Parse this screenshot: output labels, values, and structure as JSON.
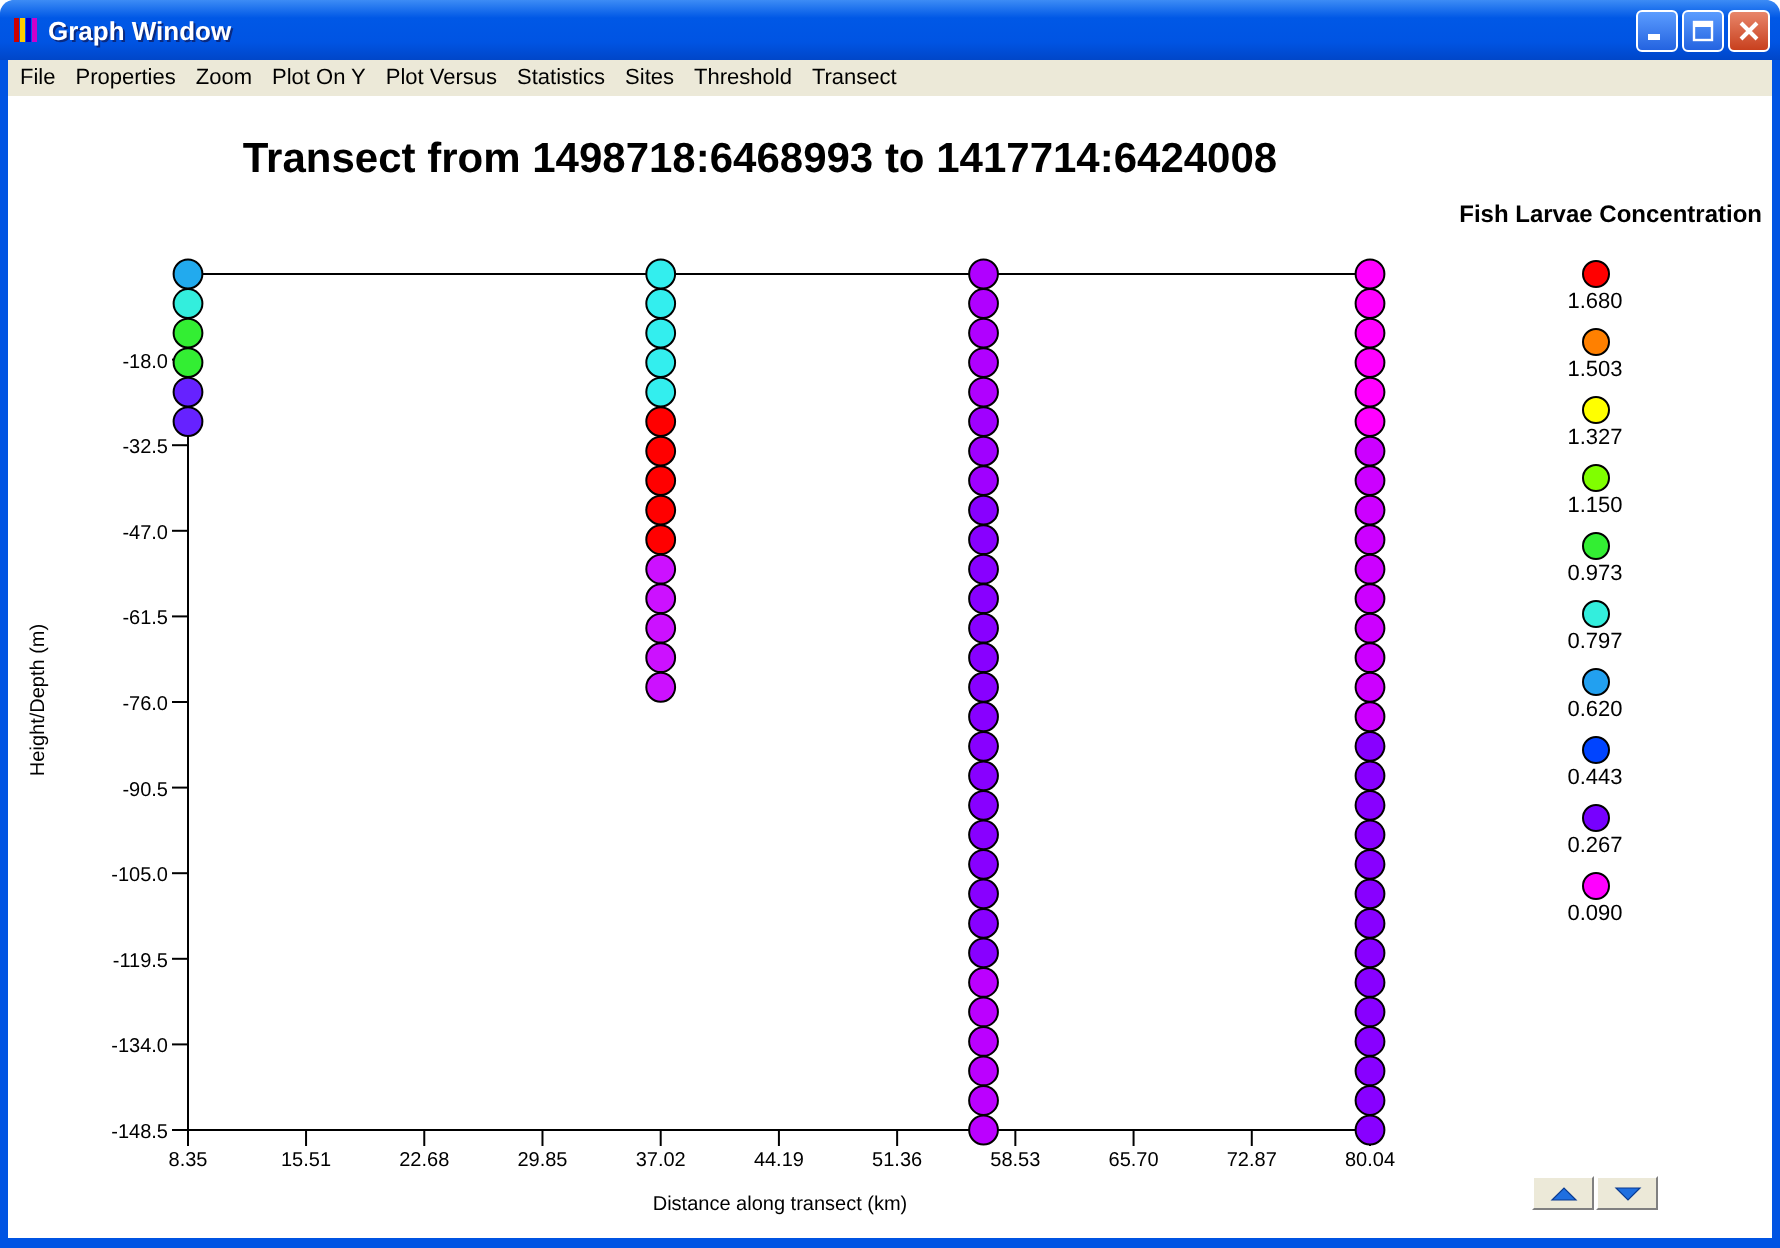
{
  "window": {
    "title": "Graph Window"
  },
  "menu": [
    "File",
    "Properties",
    "Zoom",
    "Plot On Y",
    "Plot Versus",
    "Statistics",
    "Sites",
    "Threshold",
    "Transect"
  ],
  "chart": {
    "chart_data": {
      "type": "scatter",
      "title": "Transect from 1498718:6468993 to 1417714:6424008",
      "xlabel": "Distance along transect (km)",
      "ylabel": "Height/Depth (m)",
      "xlim": [
        8.35,
        80.04
      ],
      "ylim": [
        -148.5,
        -3.5
      ],
      "xticks": [
        {
          "value": 8.35,
          "label": "8.35"
        },
        {
          "value": 15.51,
          "label": "15.51"
        },
        {
          "value": 22.68,
          "label": "22.68"
        },
        {
          "value": 29.85,
          "label": "29.85"
        },
        {
          "value": 37.02,
          "label": "37.02"
        },
        {
          "value": 44.19,
          "label": "44.19"
        },
        {
          "value": 51.36,
          "label": "51.36"
        },
        {
          "value": 58.53,
          "label": "58.53"
        },
        {
          "value": 65.7,
          "label": "65.70"
        },
        {
          "value": 72.87,
          "label": "72.87"
        },
        {
          "value": 80.04,
          "label": "80.04"
        }
      ],
      "yticks": [
        {
          "value": -18,
          "label": "-18.0"
        },
        {
          "value": -32.5,
          "label": "-32.5"
        },
        {
          "value": -47,
          "label": "-47.0"
        },
        {
          "value": -61.5,
          "label": "-61.5"
        },
        {
          "value": -76,
          "label": "-76.0"
        },
        {
          "value": -90.5,
          "label": "-90.5"
        },
        {
          "value": -105,
          "label": "-105.0"
        },
        {
          "value": -119.5,
          "label": "-119.5"
        },
        {
          "value": -134,
          "label": "-134.0"
        },
        {
          "value": -148.5,
          "label": "-148.5"
        }
      ],
      "series": [
        {
          "x": [
            8.35,
            8.35,
            8.35,
            8.35,
            8.35,
            8.35
          ],
          "values": [
            -3.5,
            -8.5,
            -13.5,
            -18.5,
            -23.5,
            -28.5
          ],
          "colors": [
            "#22aaee",
            "#33eedd",
            "#33ee33",
            "#33ee33",
            "#6622ff",
            "#6622ff"
          ]
        },
        {
          "x": [
            37.02,
            37.02,
            37.02,
            37.02,
            37.02,
            37.02,
            37.02,
            37.02,
            37.02,
            37.02,
            37.02,
            37.02,
            37.02,
            37.02,
            37.02
          ],
          "values": [
            -3.5,
            -8.5,
            -13.5,
            -18.5,
            -23.5,
            -28.5,
            -33.5,
            -38.5,
            -43.5,
            -48.5,
            -53.5,
            -58.5,
            -63.5,
            -68.5,
            -73.5
          ],
          "colors": [
            "#33eeee",
            "#33eeee",
            "#33eeee",
            "#33eeee",
            "#33eeee",
            "#ff0000",
            "#ff0000",
            "#ff0000",
            "#ff0000",
            "#ff0000",
            "#cc11ff",
            "#cc11ff",
            "#cc11ff",
            "#cc11ff",
            "#cc11ff"
          ]
        },
        {
          "x": [
            56.6,
            56.6,
            56.6,
            56.6,
            56.6,
            56.6,
            56.6,
            56.6,
            56.6,
            56.6,
            56.6,
            56.6,
            56.6,
            56.6,
            56.6,
            56.6,
            56.6,
            56.6,
            56.6,
            56.6,
            56.6,
            56.6,
            56.6,
            56.6,
            56.6,
            56.6,
            56.6,
            56.6,
            56.6,
            56.6
          ],
          "values": [
            -3.5,
            -8.5,
            -13.5,
            -18.5,
            -23.5,
            -28.5,
            -33.5,
            -38.5,
            -43.5,
            -48.5,
            -53.5,
            -58.5,
            -63.5,
            -68.5,
            -73.5,
            -78.5,
            -83.5,
            -88.5,
            -93.5,
            -98.5,
            -103.5,
            -108.5,
            -113.5,
            -118.5,
            -123.5,
            -128.5,
            -133.5,
            -138.5,
            -143.5,
            -148.5
          ],
          "colors": [
            "#b000ff",
            "#b000ff",
            "#b000ff",
            "#b000ff",
            "#b000ff",
            "#a000ff",
            "#a000ff",
            "#a000ff",
            "#8800ff",
            "#8800ff",
            "#8800ff",
            "#8800ff",
            "#8800ff",
            "#8800ff",
            "#8800ff",
            "#8800ff",
            "#8800ff",
            "#8800ff",
            "#8800ff",
            "#8800ff",
            "#8800ff",
            "#8800ff",
            "#8800ff",
            "#8800ff",
            "#bb00ff",
            "#bb00ff",
            "#bb00ff",
            "#bb00ff",
            "#bb00ff",
            "#bb00ff"
          ]
        },
        {
          "x": [
            80.04,
            80.04,
            80.04,
            80.04,
            80.04,
            80.04,
            80.04,
            80.04,
            80.04,
            80.04,
            80.04,
            80.04,
            80.04,
            80.04,
            80.04,
            80.04,
            80.04,
            80.04,
            80.04,
            80.04,
            80.04,
            80.04,
            80.04,
            80.04,
            80.04,
            80.04,
            80.04,
            80.04,
            80.04,
            80.04
          ],
          "values": [
            -3.5,
            -8.5,
            -13.5,
            -18.5,
            -23.5,
            -28.5,
            -33.5,
            -38.5,
            -43.5,
            -48.5,
            -53.5,
            -58.5,
            -63.5,
            -68.5,
            -73.5,
            -78.5,
            -83.5,
            -88.5,
            -93.5,
            -98.5,
            -103.5,
            -108.5,
            -113.5,
            -118.5,
            -123.5,
            -128.5,
            -133.5,
            -138.5,
            -143.5,
            -148.5
          ],
          "colors": [
            "#ff00ff",
            "#ff00ff",
            "#ff00ff",
            "#ff00ff",
            "#ff00ff",
            "#ff00ff",
            "#cc00ff",
            "#cc00ff",
            "#cc00ff",
            "#cc00ff",
            "#cc00ff",
            "#cc00ff",
            "#cc00ff",
            "#cc00ff",
            "#cc00ff",
            "#cc00ff",
            "#8800ff",
            "#8800ff",
            "#8800ff",
            "#8800ff",
            "#8800ff",
            "#8800ff",
            "#8800ff",
            "#8800ff",
            "#8800ff",
            "#8800ff",
            "#8800ff",
            "#8800ff",
            "#8800ff",
            "#8800ff"
          ]
        }
      ]
    }
  },
  "legend": {
    "title": "Fish Larvae Concentration",
    "items": [
      {
        "label": "1.680",
        "color": "#ff0000"
      },
      {
        "label": "1.503",
        "color": "#ff8000"
      },
      {
        "label": "1.327",
        "color": "#ffff00"
      },
      {
        "label": "1.150",
        "color": "#80ff00"
      },
      {
        "label": "0.973",
        "color": "#33ee33"
      },
      {
        "label": "0.797",
        "color": "#33eedd"
      },
      {
        "label": "0.620",
        "color": "#22a0f0"
      },
      {
        "label": "0.443",
        "color": "#0044ff"
      },
      {
        "label": "0.267",
        "color": "#7700ff"
      },
      {
        "label": "0.090",
        "color": "#ff00ff"
      }
    ]
  },
  "scroll_buttons": [
    {
      "kind": "up"
    },
    {
      "kind": "down"
    }
  ]
}
